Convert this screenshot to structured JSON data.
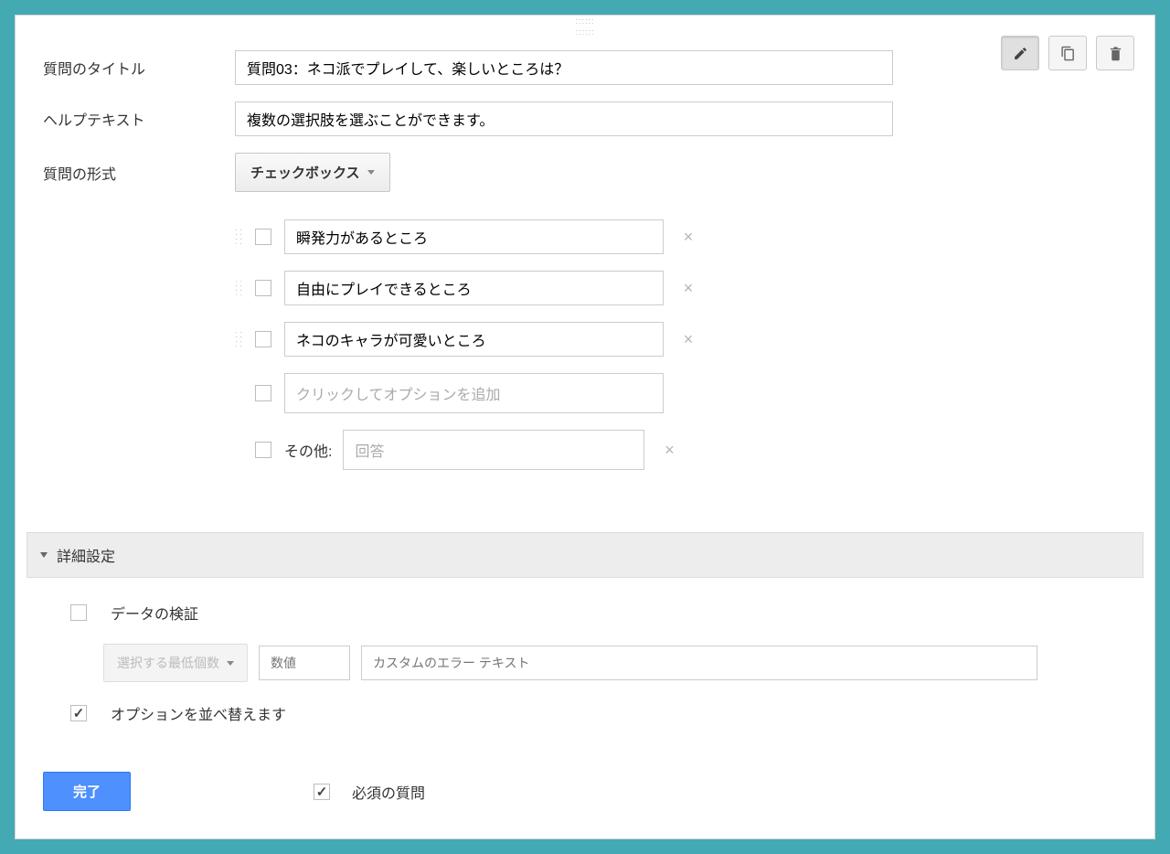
{
  "labels": {
    "title": "質問のタイトル",
    "help": "ヘルプテキスト",
    "type": "質問の形式"
  },
  "values": {
    "title": "質問03：ネコ派でプレイして、楽しいところは？",
    "help": "複数の選択肢を選ぶことができます。"
  },
  "type_selector": "チェックボックス",
  "options": [
    "瞬発力があるところ",
    "自由にプレイできるところ",
    "ネコのキャラが可愛いところ"
  ],
  "add_option_placeholder": "クリックしてオプションを追加",
  "other": {
    "label": "その他:",
    "placeholder": "回答"
  },
  "advanced": {
    "header": "詳細設定",
    "validation_label": "データの検証",
    "select_min": "選択する最低個数",
    "num_placeholder": "数値",
    "error_placeholder": "カスタムのエラー テキスト",
    "shuffle_label": "オプションを並べ替えます"
  },
  "footer": {
    "done": "完了",
    "required": "必須の質問"
  }
}
